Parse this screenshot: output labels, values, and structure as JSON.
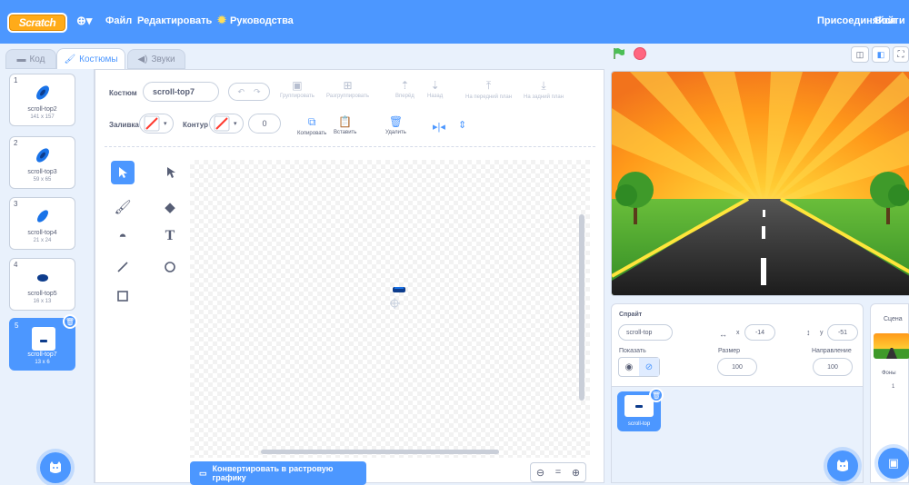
{
  "menu": {
    "logo": "Scratch",
    "file": "Файл",
    "edit": "Редактировать",
    "tutorials": "Руководства",
    "join": "Присоединяйся",
    "signin": "Войти"
  },
  "tabs": {
    "code": "Код",
    "costumes": "Костюмы",
    "sounds": "Звуки"
  },
  "costumes": [
    {
      "num": "1",
      "name": "scroll-top2",
      "size": "141 x 157"
    },
    {
      "num": "2",
      "name": "scroll-top3",
      "size": "59 x 65"
    },
    {
      "num": "3",
      "name": "scroll-top4",
      "size": "21 x 24"
    },
    {
      "num": "4",
      "name": "scroll-top5",
      "size": "16 x 13"
    },
    {
      "num": "5",
      "name": "scroll-top7",
      "size": "13 x 6"
    }
  ],
  "editor": {
    "costume_label": "Костюм",
    "costume_name": "scroll-top7",
    "group": "Группировать",
    "ungroup": "Разгруппировать",
    "forward": "Вперёд",
    "backward": "Назад",
    "front": "На передний план",
    "back": "На задний план",
    "fill_label": "Заливка",
    "outline_label": "Контур",
    "outline_width": "0",
    "copy": "Копировать",
    "paste": "Вставить",
    "delete": "Удалить",
    "convert": "Конвертировать в растровую графику"
  },
  "sprite": {
    "label": "Спрайт",
    "name": "scroll-top",
    "x_label": "x",
    "x": "-14",
    "y_label": "y",
    "y": "-51",
    "show_label": "Показать",
    "size_label": "Размер",
    "size": "100",
    "direction_label": "Направление",
    "direction": "100",
    "thumb_name": "scroll-top"
  },
  "stagepanel": {
    "title": "Сцена",
    "backdrops_label": "Фоны",
    "backdrops_count": "1"
  },
  "colors": {
    "accent": "#4c97ff",
    "menubar": "#4c97ff",
    "flag": "#4cbf56",
    "stop": "#ff6680"
  }
}
